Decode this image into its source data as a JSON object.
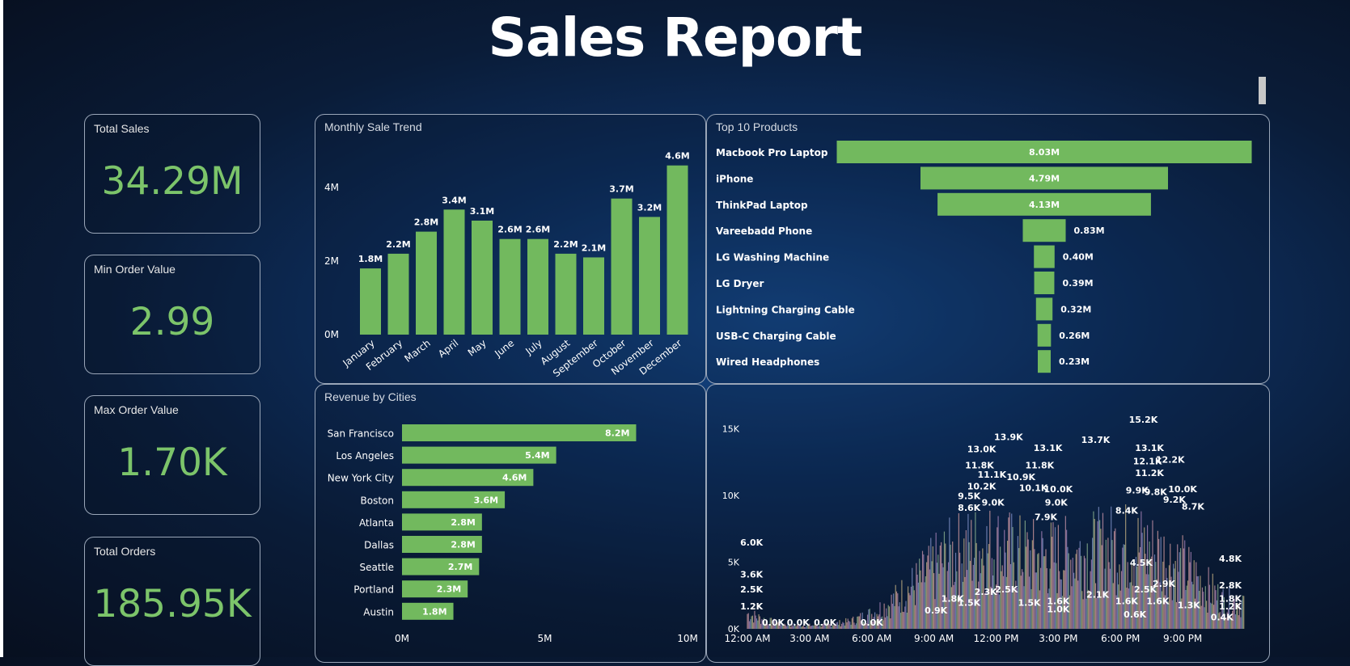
{
  "header": {
    "title": "Sales Report"
  },
  "colors": {
    "accent": "#7cc46a",
    "bar": "#72b95e",
    "text": "#ffffff"
  },
  "kpis": [
    {
      "label": "Total Sales",
      "value": "34.29M"
    },
    {
      "label": "Min Order Value",
      "value": "2.99"
    },
    {
      "label": "Max Order Value",
      "value": "1.70K"
    },
    {
      "label": "Total Orders",
      "value": "185.95K"
    }
  ],
  "panels": {
    "monthly": {
      "title": "Monthly Sale Trend"
    },
    "products": {
      "title": "Top 10 Products"
    },
    "cities": {
      "title": "Revenue by Cities"
    }
  },
  "chart_data": [
    {
      "id": "monthly",
      "type": "bar",
      "title": "Monthly Sale Trend",
      "categories": [
        "January",
        "February",
        "March",
        "April",
        "May",
        "June",
        "July",
        "August",
        "September",
        "October",
        "November",
        "December"
      ],
      "values": [
        1.8,
        2.2,
        2.8,
        3.4,
        3.1,
        2.6,
        2.6,
        2.2,
        2.1,
        3.7,
        3.2,
        4.6
      ],
      "labels": [
        "1.8M",
        "2.2M",
        "2.8M",
        "3.4M",
        "3.1M",
        "2.6M",
        "2.6M",
        "2.2M",
        "2.1M",
        "3.7M",
        "3.2M",
        "4.6M"
      ],
      "yticks": [
        "0M",
        "2M",
        "4M"
      ],
      "ylim": [
        0,
        5
      ],
      "grid": false
    },
    {
      "id": "products",
      "type": "bar",
      "orientation": "funnel",
      "title": "Top 10 Products",
      "categories": [
        "Macbook Pro Laptop",
        "iPhone",
        "ThinkPad Laptop",
        "Vareebadd Phone",
        "LG Washing Machine",
        "LG Dryer",
        "Lightning Charging Cable",
        "USB-C Charging Cable",
        "Wired Headphones"
      ],
      "values": [
        8.03,
        4.79,
        4.13,
        0.83,
        0.4,
        0.39,
        0.32,
        0.26,
        0.23
      ],
      "labels": [
        "8.03M",
        "4.79M",
        "4.13M",
        "0.83M",
        "0.40M",
        "0.39M",
        "0.32M",
        "0.26M",
        "0.23M"
      ]
    },
    {
      "id": "cities",
      "type": "bar",
      "orientation": "horizontal",
      "title": "Revenue by Cities",
      "categories": [
        "San Francisco",
        "Los Angeles",
        "New York City",
        "Boston",
        "Atlanta",
        "Dallas",
        "Seattle",
        "Portland",
        "Austin"
      ],
      "values": [
        8.2,
        5.4,
        4.6,
        3.6,
        2.8,
        2.8,
        2.7,
        2.3,
        1.8
      ],
      "labels": [
        "8.2M",
        "5.4M",
        "4.6M",
        "3.6M",
        "2.8M",
        "2.8M",
        "2.7M",
        "2.3M",
        "1.8M"
      ],
      "xticks": [
        "0M",
        "5M",
        "10M"
      ],
      "xlim": [
        0,
        10
      ]
    },
    {
      "id": "hourly",
      "type": "area",
      "title": "",
      "xticks": [
        "12:00 AM",
        "3:00 AM",
        "6:00 AM",
        "9:00 AM",
        "12:00 PM",
        "3:00 PM",
        "6:00 PM",
        "9:00 PM"
      ],
      "yticks": [
        "0K",
        "5K",
        "10K",
        "15K"
      ],
      "ylim": [
        0,
        15
      ],
      "xlim": [
        0,
        24
      ],
      "data_labels": [
        {
          "x": 0.2,
          "y": 6.0,
          "t": "6.0K"
        },
        {
          "x": 0.2,
          "y": 3.6,
          "t": "3.6K"
        },
        {
          "x": 0.2,
          "y": 2.5,
          "t": "2.5K"
        },
        {
          "x": 0.2,
          "y": 1.2,
          "t": "1.2K"
        },
        {
          "x": 1.25,
          "y": 0.0,
          "t": "0.0K"
        },
        {
          "x": 2.45,
          "y": 0.0,
          "t": "0.0K"
        },
        {
          "x": 3.75,
          "y": 0.0,
          "t": "0.0K"
        },
        {
          "x": 6.0,
          "y": 0.0,
          "t": "0.0K"
        },
        {
          "x": 10.7,
          "y": 9.5,
          "t": "9.5K"
        },
        {
          "x": 10.7,
          "y": 8.6,
          "t": "8.6K"
        },
        {
          "x": 11.2,
          "y": 11.8,
          "t": "11.8K"
        },
        {
          "x": 11.3,
          "y": 10.2,
          "t": "10.2K"
        },
        {
          "x": 11.3,
          "y": 13.0,
          "t": "13.0K"
        },
        {
          "x": 11.8,
          "y": 11.1,
          "t": "11.1K"
        },
        {
          "x": 11.85,
          "y": 9.0,
          "t": "9.0K"
        },
        {
          "x": 12.6,
          "y": 13.9,
          "t": "13.9K"
        },
        {
          "x": 13.2,
          "y": 10.9,
          "t": "10.9K"
        },
        {
          "x": 13.8,
          "y": 10.1,
          "t": "10.1K"
        },
        {
          "x": 14.1,
          "y": 11.8,
          "t": "11.8K"
        },
        {
          "x": 14.5,
          "y": 13.1,
          "t": "13.1K"
        },
        {
          "x": 15.0,
          "y": 10.0,
          "t": "10.0K"
        },
        {
          "x": 14.9,
          "y": 9.0,
          "t": "9.0K"
        },
        {
          "x": 14.4,
          "y": 7.9,
          "t": "7.9K"
        },
        {
          "x": 16.8,
          "y": 13.7,
          "t": "13.7K"
        },
        {
          "x": 19.1,
          "y": 15.2,
          "t": "15.2K"
        },
        {
          "x": 18.8,
          "y": 9.9,
          "t": "9.9K"
        },
        {
          "x": 18.3,
          "y": 8.4,
          "t": "8.4K"
        },
        {
          "x": 19.4,
          "y": 13.1,
          "t": "13.1K"
        },
        {
          "x": 19.3,
          "y": 12.1,
          "t": "12.1K"
        },
        {
          "x": 19.4,
          "y": 11.2,
          "t": "11.2K"
        },
        {
          "x": 20.4,
          "y": 12.2,
          "t": "12.2K"
        },
        {
          "x": 19.7,
          "y": 9.8,
          "t": "9.8K"
        },
        {
          "x": 21.0,
          "y": 10.0,
          "t": "10.0K"
        },
        {
          "x": 20.6,
          "y": 9.2,
          "t": "9.2K"
        },
        {
          "x": 21.5,
          "y": 8.7,
          "t": "8.7K"
        },
        {
          "x": 9.1,
          "y": 0.9,
          "t": "0.9K"
        },
        {
          "x": 9.9,
          "y": 1.8,
          "t": "1.8K"
        },
        {
          "x": 10.7,
          "y": 1.5,
          "t": "1.5K"
        },
        {
          "x": 11.5,
          "y": 2.3,
          "t": "2.3K"
        },
        {
          "x": 12.5,
          "y": 2.5,
          "t": "2.5K"
        },
        {
          "x": 13.6,
          "y": 1.5,
          "t": "1.5K"
        },
        {
          "x": 15.0,
          "y": 1.6,
          "t": "1.6K"
        },
        {
          "x": 15.0,
          "y": 1.0,
          "t": "1.0K"
        },
        {
          "x": 16.9,
          "y": 2.1,
          "t": "2.1K"
        },
        {
          "x": 18.3,
          "y": 1.6,
          "t": "1.6K"
        },
        {
          "x": 18.7,
          "y": 0.6,
          "t": "0.6K"
        },
        {
          "x": 19.0,
          "y": 4.5,
          "t": "4.5K"
        },
        {
          "x": 19.2,
          "y": 2.5,
          "t": "2.5K"
        },
        {
          "x": 20.1,
          "y": 2.9,
          "t": "2.9K"
        },
        {
          "x": 19.8,
          "y": 1.6,
          "t": "1.6K"
        },
        {
          "x": 21.3,
          "y": 1.3,
          "t": "1.3K"
        },
        {
          "x": 23.3,
          "y": 4.8,
          "t": "4.8K"
        },
        {
          "x": 23.3,
          "y": 2.8,
          "t": "2.8K"
        },
        {
          "x": 23.3,
          "y": 1.8,
          "t": "1.8K"
        },
        {
          "x": 23.3,
          "y": 1.2,
          "t": "1.2K"
        },
        {
          "x": 22.9,
          "y": 0.4,
          "t": "0.4K"
        }
      ]
    }
  ]
}
